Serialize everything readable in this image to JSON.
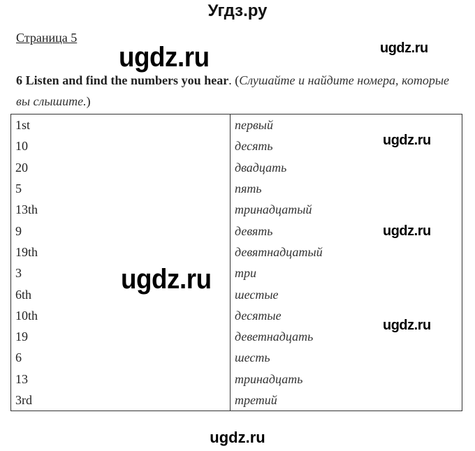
{
  "header": {
    "site_title": "Угдз.ру",
    "page_label": "Страница 5"
  },
  "watermarks": {
    "text": "ugdz.ru"
  },
  "task": {
    "number": "6",
    "instruction_en": "Listen and find the numbers you hear",
    "period": ". (",
    "instruction_ru": "Слушайте и найдите номера, которые вы слышите.",
    "close": ")"
  },
  "table": {
    "rows": [
      {
        "en": "1st",
        "ru": "первый"
      },
      {
        "en": "10",
        "ru": "десять"
      },
      {
        "en": "20",
        "ru": "двадцать"
      },
      {
        "en": "5",
        "ru": "пять"
      },
      {
        "en": "13th",
        "ru": "тринадцатый"
      },
      {
        "en": "9",
        "ru": "девять"
      },
      {
        "en": "19th",
        "ru": "девятнадцатый"
      },
      {
        "en": "3",
        "ru": "три"
      },
      {
        "en": "6th",
        "ru": "шестые"
      },
      {
        "en": "10th",
        "ru": "десятые"
      },
      {
        "en": "19",
        "ru": "деветнадцать"
      },
      {
        "en": "6",
        "ru": "шесть"
      },
      {
        "en": "13",
        "ru": "тринадцать"
      },
      {
        "en": "3rd",
        "ru": "третий"
      }
    ]
  },
  "footer": {
    "watermark": "ugdz.ru"
  }
}
